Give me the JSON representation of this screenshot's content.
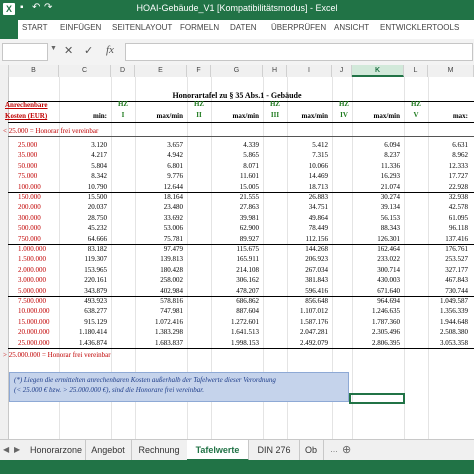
{
  "window": {
    "title": "HOAI-Gebäude_V1 [Kompatibilitätsmodus] - Excel"
  },
  "ribbon": {
    "file_label": "",
    "tabs": [
      "START",
      "EINFÜGEN",
      "SEITENLAYOUT",
      "FORMELN",
      "DATEN",
      "ÜBERPRÜFEN",
      "ANSICHT",
      "ENTWICKLERTOOLS"
    ]
  },
  "formula_bar": {
    "fx": "fx",
    "cancel": "✕",
    "confirm": "✓",
    "value": ""
  },
  "columns": [
    "B",
    "C",
    "D",
    "E",
    "F",
    "G",
    "H",
    "I",
    "J",
    "K",
    "L",
    "M"
  ],
  "selected_column": "K",
  "sheet": {
    "title": "Honorartafel zu § 35 Abs.1 - Gebäude",
    "header": {
      "anrechenbare": "Anrechenbare",
      "kosten": "Kosten (EUR)",
      "hz": [
        "HZ",
        "HZ",
        "HZ",
        "HZ",
        "HZ"
      ],
      "hz_roman": [
        "I",
        "II",
        "III",
        "IV",
        "V"
      ],
      "min": "min:",
      "max_min": "max/min",
      "max": "max:"
    },
    "below_note": "< 25.000 = Honorar frei vereinbar",
    "above_note": "> 25.000.000 = Honorar frei vereinbar",
    "rows": [
      [
        "25.000",
        "3.120",
        "3.657",
        "4.339",
        "5.412",
        "6.094",
        "6.631"
      ],
      [
        "35.000",
        "4.217",
        "4.942",
        "5.865",
        "7.315",
        "8.237",
        "8.962"
      ],
      [
        "50.000",
        "5.804",
        "6.801",
        "8.071",
        "10.066",
        "11.336",
        "12.333"
      ],
      [
        "75.000",
        "8.342",
        "9.776",
        "11.601",
        "14.469",
        "16.293",
        "17.727"
      ],
      [
        "100.000",
        "10.790",
        "12.644",
        "15.005",
        "18.713",
        "21.074",
        "22.928"
      ],
      [
        "150.000",
        "15.500",
        "18.164",
        "21.555",
        "26.883",
        "30.274",
        "32.938"
      ],
      [
        "200.000",
        "20.037",
        "23.480",
        "27.863",
        "34.751",
        "39.134",
        "42.578"
      ],
      [
        "300.000",
        "28.750",
        "33.692",
        "39.981",
        "49.864",
        "56.153",
        "61.095"
      ],
      [
        "500.000",
        "45.232",
        "53.006",
        "62.900",
        "78.449",
        "88.343",
        "96.118"
      ],
      [
        "750.000",
        "64.666",
        "75.781",
        "89.927",
        "112.156",
        "126.301",
        "137.416"
      ],
      [
        "1.000.000",
        "83.182",
        "97.479",
        "115.675",
        "144.268",
        "162.464",
        "176.761"
      ],
      [
        "1.500.000",
        "119.307",
        "139.813",
        "165.911",
        "206.923",
        "233.022",
        "253.527"
      ],
      [
        "2.000.000",
        "153.965",
        "180.428",
        "214.108",
        "267.034",
        "300.714",
        "327.177"
      ],
      [
        "3.000.000",
        "220.161",
        "258.002",
        "306.162",
        "381.843",
        "430.003",
        "467.843"
      ],
      [
        "5.000.000",
        "343.879",
        "402.984",
        "478.207",
        "596.416",
        "671.640",
        "730.744"
      ],
      [
        "7.500.000",
        "493.923",
        "578.816",
        "686.862",
        "856.648",
        "964.694",
        "1.049.587"
      ],
      [
        "10.000.000",
        "638.277",
        "747.981",
        "887.604",
        "1.107.012",
        "1.246.635",
        "1.356.339"
      ],
      [
        "15.000.000",
        "915.129",
        "1.072.416",
        "1.272.601",
        "1.587.176",
        "1.787.360",
        "1.944.648"
      ],
      [
        "20.000.000",
        "1.180.414",
        "1.383.298",
        "1.641.513",
        "2.047.281",
        "2.305.496",
        "2.508.380"
      ],
      [
        "25.000.000",
        "1.436.874",
        "1.683.837",
        "1.998.153",
        "2.492.079",
        "2.806.395",
        "3.053.358"
      ]
    ],
    "footnote_line1": "(*) Liegen die ermittelten anrechenbaren Kosten außerhalb der Tafelwerte dieser Verordnung",
    "footnote_line2": "(< 25.000 € bzw. > 25.000.000 €), sind die Honorare frei vereinbar."
  },
  "sheet_tabs": [
    "Honorarzone",
    "Angebot",
    "Rechnung",
    "Tafelwerte",
    "DIN 276",
    "Ob"
  ],
  "active_sheet_tab": "Tafelwerte",
  "colors": {
    "excel_green": "#217346",
    "red_text": "#c00000",
    "hz_green": "#1d7a1d",
    "note_bg": "#c5d3eb"
  }
}
